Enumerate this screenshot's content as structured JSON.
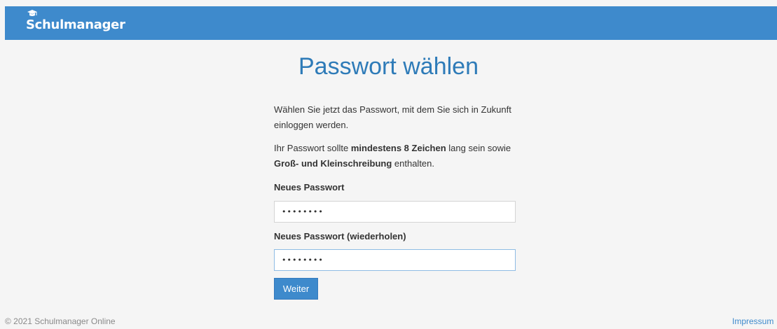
{
  "header": {
    "brand": "Schulmanager",
    "brand_icon": "graduation-cap-icon"
  },
  "page": {
    "title": "Passwort wählen"
  },
  "intro": {
    "line1": "Wählen Sie jetzt das Passwort, mit dem Sie sich in Zukunft einloggen werden.",
    "requirements_prefix": "Ihr Passwort sollte ",
    "requirements_bold1": "mindestens 8 Zeichen",
    "requirements_mid": " lang sein sowie ",
    "requirements_bold2": "Groß- und Kleinschreibung",
    "requirements_suffix": " enthalten."
  },
  "form": {
    "new_password_label": "Neues Passwort",
    "new_password_value": "••••••••",
    "repeat_password_label": "Neues Passwort (wiederholen)",
    "repeat_password_value": "••••••••",
    "submit_label": "Weiter"
  },
  "footer": {
    "copyright": "© 2021 Schulmanager Online",
    "impressum": "Impressum"
  },
  "colors": {
    "primary": "#3e8acc",
    "title": "#2e7bb8",
    "background": "#f5f5f5"
  }
}
